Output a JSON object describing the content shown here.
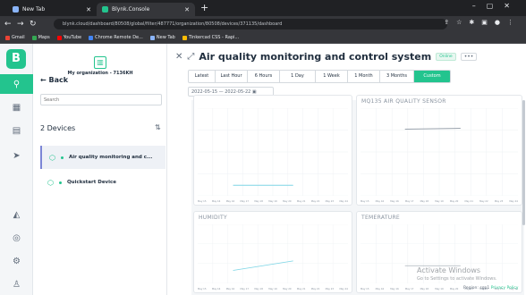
{
  "browser": {
    "tabs": [
      {
        "label": "New Tab",
        "favicon_color": "#8ab4f8",
        "active": false
      },
      {
        "label": "Blynk.Console",
        "favicon_color": "#23c48e",
        "active": true
      }
    ],
    "url": "blynk.cloud/dashboard/80508/global/filter/487771/organization/80508/devices/371135/dashboard",
    "bookmarks": [
      {
        "label": "Gmail",
        "color": "#ea4335"
      },
      {
        "label": "Maps",
        "color": "#34a853"
      },
      {
        "label": "YouTube",
        "color": "#ff0000"
      },
      {
        "label": "Chrome Remote De...",
        "color": "#4285f4"
      },
      {
        "label": "New Tab",
        "color": "#8ab4f8"
      },
      {
        "label": "Tinkercad CSS - Rapi...",
        "color": "#fbbc04"
      }
    ]
  },
  "app": {
    "logo": "B",
    "rail_icons": [
      "search-icon",
      "grid-icon",
      "clipboard-icon",
      "send-icon",
      "megaphone-icon",
      "globe-icon",
      "settings-icon",
      "user-icon"
    ],
    "org_name": "My organization - 7136KH",
    "back_label": "Back",
    "search_placeholder": "Search",
    "devices_count": "2 Devices",
    "devices": [
      {
        "name": "Air quality monitoring and c...",
        "selected": true
      },
      {
        "name": "Quickstart Device",
        "selected": false
      }
    ]
  },
  "main": {
    "title": "Air quality monitoring and control system",
    "status_badge": "Online",
    "more_label": "•••",
    "time_ranges": [
      "Latest",
      "Last Hour",
      "6 Hours",
      "1 Day",
      "1 Week",
      "1 Month",
      "3 Months",
      "Custom"
    ],
    "active_range": "Custom",
    "date_from": "2022-05-15",
    "date_to": "2022-05-22",
    "date_separator": "—",
    "x_ticks": [
      "May 15",
      "May 16",
      "May 16",
      "May 17",
      "May 18",
      "May 19",
      "May 20",
      "May 21",
      "May 22",
      "May 23",
      "May 24"
    ],
    "cards": [
      {
        "title": "",
        "line_color": "#7ed6e6"
      },
      {
        "title": "MQ135 AIR QUALITY SENSOR",
        "line_color": "#9aa3ad"
      },
      {
        "title": "HUMIDITY",
        "line_color": "#7ed6e6"
      },
      {
        "title": "TEMERATURE",
        "line_color": "#9aa3ad"
      }
    ]
  },
  "os": {
    "watermark_title": "Activate Windows",
    "watermark_sub": "Go to Settings to activate Windows.",
    "region": "Region: sgp1",
    "privacy": "Privacy Policy"
  }
}
